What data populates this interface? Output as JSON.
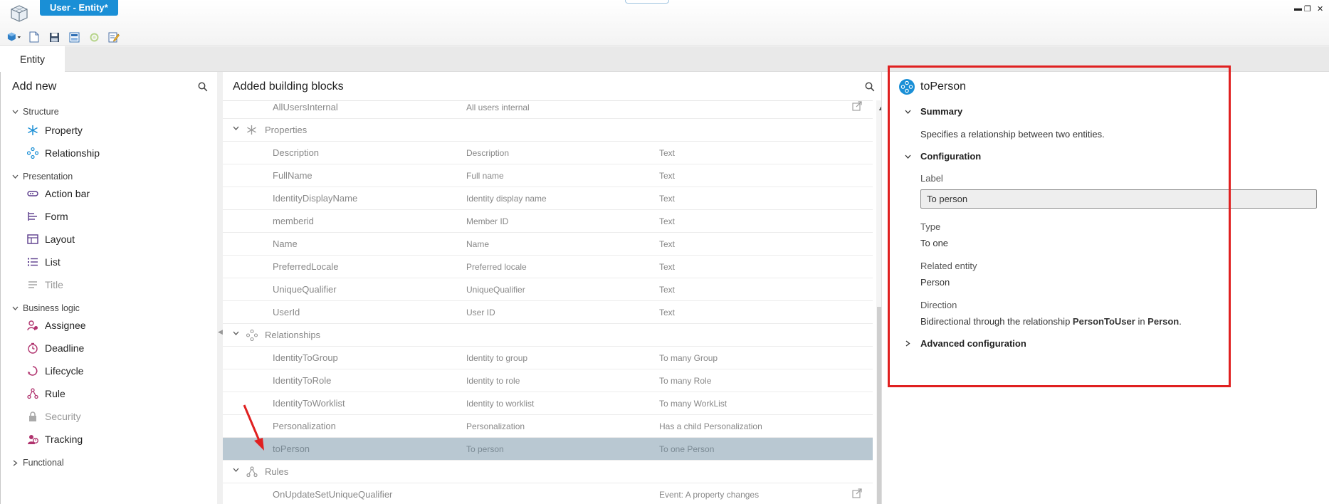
{
  "window": {
    "document_tab": "User - Entity*",
    "controls": {
      "minimize": "▬",
      "restore": "❐",
      "close": "✕"
    }
  },
  "tabs": {
    "active": "Entity"
  },
  "left_panel": {
    "title": "Add new",
    "groups": [
      {
        "label": "Structure",
        "expanded": true,
        "items": [
          {
            "label": "Property",
            "icon": "asterisk-icon",
            "disabled": false
          },
          {
            "label": "Relationship",
            "icon": "relationship-icon",
            "disabled": false
          }
        ]
      },
      {
        "label": "Presentation",
        "expanded": true,
        "items": [
          {
            "label": "Action bar",
            "icon": "action-bar-icon",
            "disabled": false
          },
          {
            "label": "Form",
            "icon": "form-icon",
            "disabled": false
          },
          {
            "label": "Layout",
            "icon": "layout-icon",
            "disabled": false
          },
          {
            "label": "List",
            "icon": "list-icon",
            "disabled": false
          },
          {
            "label": "Title",
            "icon": "title-icon",
            "disabled": true
          }
        ]
      },
      {
        "label": "Business logic",
        "expanded": true,
        "items": [
          {
            "label": "Assignee",
            "icon": "assignee-icon",
            "disabled": false
          },
          {
            "label": "Deadline",
            "icon": "deadline-icon",
            "disabled": false
          },
          {
            "label": "Lifecycle",
            "icon": "lifecycle-icon",
            "disabled": false
          },
          {
            "label": "Rule",
            "icon": "rule-icon",
            "disabled": false
          },
          {
            "label": "Security",
            "icon": "lock-icon",
            "disabled": true
          },
          {
            "label": "Tracking",
            "icon": "tracking-icon",
            "disabled": false
          }
        ]
      },
      {
        "label": "Functional",
        "expanded": false,
        "items": []
      }
    ]
  },
  "mid_panel": {
    "title": "Added building blocks",
    "top_row": {
      "name": "AllUsersInternal",
      "label": "All users internal",
      "type": ""
    },
    "sections": [
      {
        "label": "Properties",
        "icon": "asterisk-icon",
        "rows": [
          {
            "name": "Description",
            "label": "Description",
            "type": "Text"
          },
          {
            "name": "FullName",
            "label": "Full name",
            "type": "Text"
          },
          {
            "name": "IdentityDisplayName",
            "label": "Identity display name",
            "type": "Text"
          },
          {
            "name": "memberid",
            "label": "Member ID",
            "type": "Text"
          },
          {
            "name": "Name",
            "label": "Name",
            "type": "Text"
          },
          {
            "name": "PreferredLocale",
            "label": "Preferred locale",
            "type": "Text"
          },
          {
            "name": "UniqueQualifier",
            "label": "UniqueQualifier",
            "type": "Text"
          },
          {
            "name": "UserId",
            "label": "User ID",
            "type": "Text"
          }
        ]
      },
      {
        "label": "Relationships",
        "icon": "relationship-icon",
        "rows": [
          {
            "name": "IdentityToGroup",
            "label": "Identity to group",
            "type": "To many Group"
          },
          {
            "name": "IdentityToRole",
            "label": "Identity to role",
            "type": "To many Role"
          },
          {
            "name": "IdentityToWorklist",
            "label": "Identity to worklist",
            "type": "To many WorkList"
          },
          {
            "name": "Personalization",
            "label": "Personalization",
            "type": "Has a child Personalization"
          },
          {
            "name": "toPerson",
            "label": "To person",
            "type": "To one Person",
            "selected": true
          }
        ]
      },
      {
        "label": "Rules",
        "icon": "rule-icon",
        "rows": [
          {
            "name": "OnUpdateSetUniqueQualifier",
            "label": "",
            "type": "Event: A property changes"
          }
        ]
      }
    ]
  },
  "right_panel": {
    "title": "toPerson",
    "summary": {
      "heading": "Summary",
      "text": "Specifies a relationship between two entities."
    },
    "configuration": {
      "heading": "Configuration",
      "label_caption": "Label",
      "label_value": "To person",
      "type_caption": "Type",
      "type_value": "To one",
      "related_caption": "Related entity",
      "related_value": "Person",
      "direction_caption": "Direction",
      "direction_pre": "Bidirectional through the relationship ",
      "direction_rel": "PersonToUser",
      "direction_mid": " in ",
      "direction_entity": "Person",
      "direction_end": "."
    },
    "advanced": {
      "heading": "Advanced configuration"
    }
  },
  "colors": {
    "accent": "#1a8fd6",
    "highlight": "#e02020",
    "selected_row": "#b9c8d2"
  }
}
